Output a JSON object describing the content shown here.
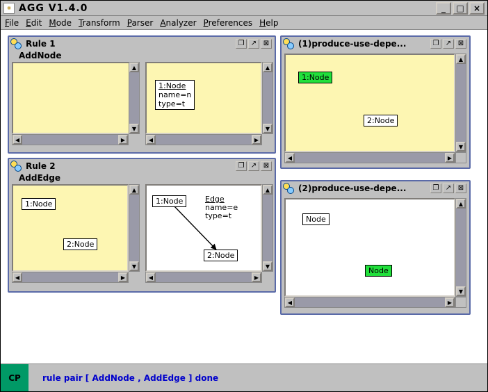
{
  "window": {
    "title": "AGG  V1.4.0",
    "controls": {
      "min": "_",
      "max": "□",
      "close": "×"
    }
  },
  "menu": {
    "items": [
      "File",
      "Edit",
      "Mode",
      "Transform",
      "Parser",
      "Analyzer",
      "Preferences",
      "Help"
    ]
  },
  "rule1": {
    "frame_title": "Rule 1",
    "sub_label": "AddNode",
    "left_pane": {
      "nodes": []
    },
    "right_pane": {
      "nodes": [
        {
          "id_text": "1:Node",
          "attrs": [
            "name=n",
            "type=t"
          ]
        }
      ]
    },
    "btns": {
      "restore": "❐",
      "max": "↗",
      "close": "⊠"
    }
  },
  "rule2": {
    "frame_title": "Rule 2",
    "sub_label": "AddEdge",
    "left_pane": {
      "nodes": [
        {
          "id_text": "1:Node"
        },
        {
          "id_text": "2:Node"
        }
      ]
    },
    "right_pane": {
      "nodes": [
        {
          "id_text": "1:Node"
        },
        {
          "id_text": "2:Node"
        }
      ],
      "edge": {
        "label_title": "Edge",
        "attrs": [
          "name=e",
          "type=t"
        ]
      }
    },
    "btns": {
      "restore": "❐",
      "max": "↗",
      "close": "⊠"
    }
  },
  "dep1": {
    "frame_title": "(1)produce-use-depe...",
    "nodes": [
      {
        "id_text": "1:Node",
        "hilite": true
      },
      {
        "id_text": "2:Node",
        "hilite": false
      }
    ],
    "btns": {
      "restore": "❐",
      "max": "↗",
      "close": "⊠"
    }
  },
  "dep2": {
    "frame_title": "(2)produce-use-depe...",
    "nodes": [
      {
        "id_text": "Node",
        "hilite": false
      },
      {
        "id_text": "Node",
        "hilite": true
      }
    ],
    "btns": {
      "restore": "❐",
      "max": "↗",
      "close": "⊠"
    }
  },
  "status": {
    "cp_label": "CP",
    "message": "rule pair  [ AddNode , AddEdge ]  done"
  }
}
